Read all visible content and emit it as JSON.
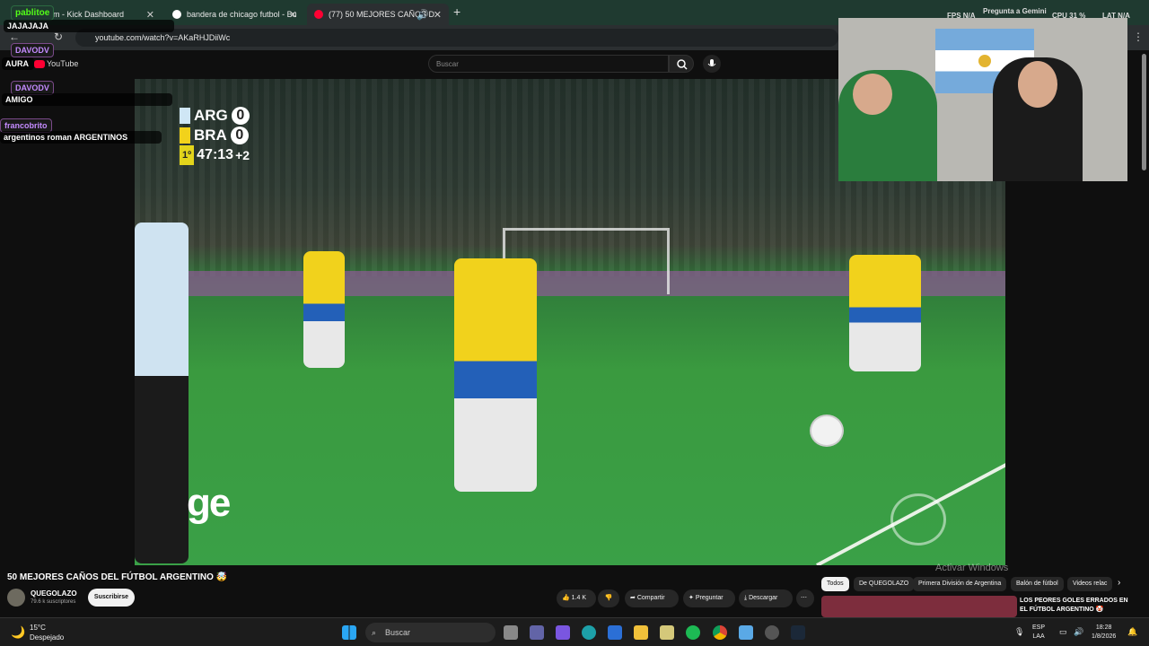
{
  "browser": {
    "tabs": [
      {
        "label": "am - Kick Dashboard",
        "favicon": "kick-icon"
      },
      {
        "label": "bandera de chicago futbol - Bu",
        "favicon": "google-icon"
      },
      {
        "label": "(77) 50 MEJORES CAÑOS D",
        "favicon": "youtube-icon"
      }
    ],
    "url": "youtube.com/watch?v=AKaRHJDiiWc"
  },
  "overlay_hw": {
    "fps": "FPS N/A",
    "gemini": "Pregunta a Gemini",
    "cpu": "CPU 31 %",
    "lat": "LAT N/A"
  },
  "youtube": {
    "logo": "YouTube",
    "search_placeholder": "Buscar",
    "video_title": "50 MEJORES CAÑOS DEL FÚTBOL ARGENTINO 🤯",
    "channel_name": "QUEGOLAZO",
    "subscribers": "79.6 k suscriptores",
    "subscribe_label": "Suscribirse",
    "likes": "1.4 K",
    "share_label": "Compartir",
    "ask_label": "Preguntar",
    "download_label": "Descargar",
    "chips": [
      "Todos",
      "De QUEGOLAZO",
      "Primera División de Argentina",
      "Balón de fútbol",
      "Videos relac"
    ],
    "rec_title": "LOS PEORES GOLES ERRADOS EN EL FÚTBOL ARGENTINO 🤡",
    "activate_windows": "Activar Windows"
  },
  "scoreboard": {
    "team1": "ARG",
    "score1": "0",
    "color1": "#cfe6f5",
    "team2": "BRA",
    "score2": "0",
    "color2": "#f2d21b",
    "period": "1º",
    "time": "47:13",
    "added": "+2"
  },
  "broadcaster_logo": "ge",
  "chat": [
    {
      "user": "pablitoe",
      "message": "JAJAJAJA",
      "color": "#53fc18"
    },
    {
      "user": "DAVODV",
      "message": "AURA",
      "color": "#c48bff"
    },
    {
      "user": "DAVODV",
      "message": "AMIGO",
      "color": "#c48bff"
    },
    {
      "user": "francobrito",
      "message": "argentinos roman ARGENTINOS",
      "color": "#c48bff"
    }
  ],
  "taskbar": {
    "weather_temp": "15°C",
    "weather_desc": "Despejado",
    "search_placeholder": "Buscar",
    "lang1": "ESP",
    "lang2": "LAA",
    "time": "18:28",
    "date": "1/8/2026"
  }
}
